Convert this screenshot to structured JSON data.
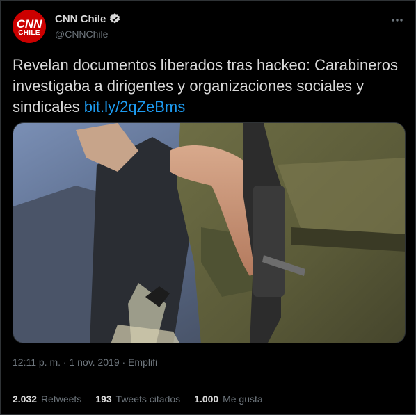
{
  "account": {
    "display_name": "CNN Chile",
    "handle": "@CNNChile",
    "avatar_top": "CNN",
    "avatar_sub": "CHILE",
    "verified": true
  },
  "tweet": {
    "text": "Revelan documentos liberados tras hackeo: Carabineros investigaba a dirigentes y organizaciones sociales y sindicales ",
    "link": "bit.ly/2qZeBms"
  },
  "media": {
    "icon": "photo-image"
  },
  "meta": {
    "time": "12:11 p. m.",
    "separator": " · ",
    "date": "1 nov. 2019",
    "source": "Emplifi"
  },
  "stats": [
    {
      "value": "2.032",
      "label": "Retweets"
    },
    {
      "value": "193",
      "label": "Tweets citados"
    },
    {
      "value": "1.000",
      "label": "Me gusta"
    }
  ],
  "colors": {
    "background": "#000000",
    "text": "#d9d9d9",
    "muted": "#6e767d",
    "link": "#1d9bf0",
    "brand": "#cc0000",
    "border": "#2f3336"
  }
}
